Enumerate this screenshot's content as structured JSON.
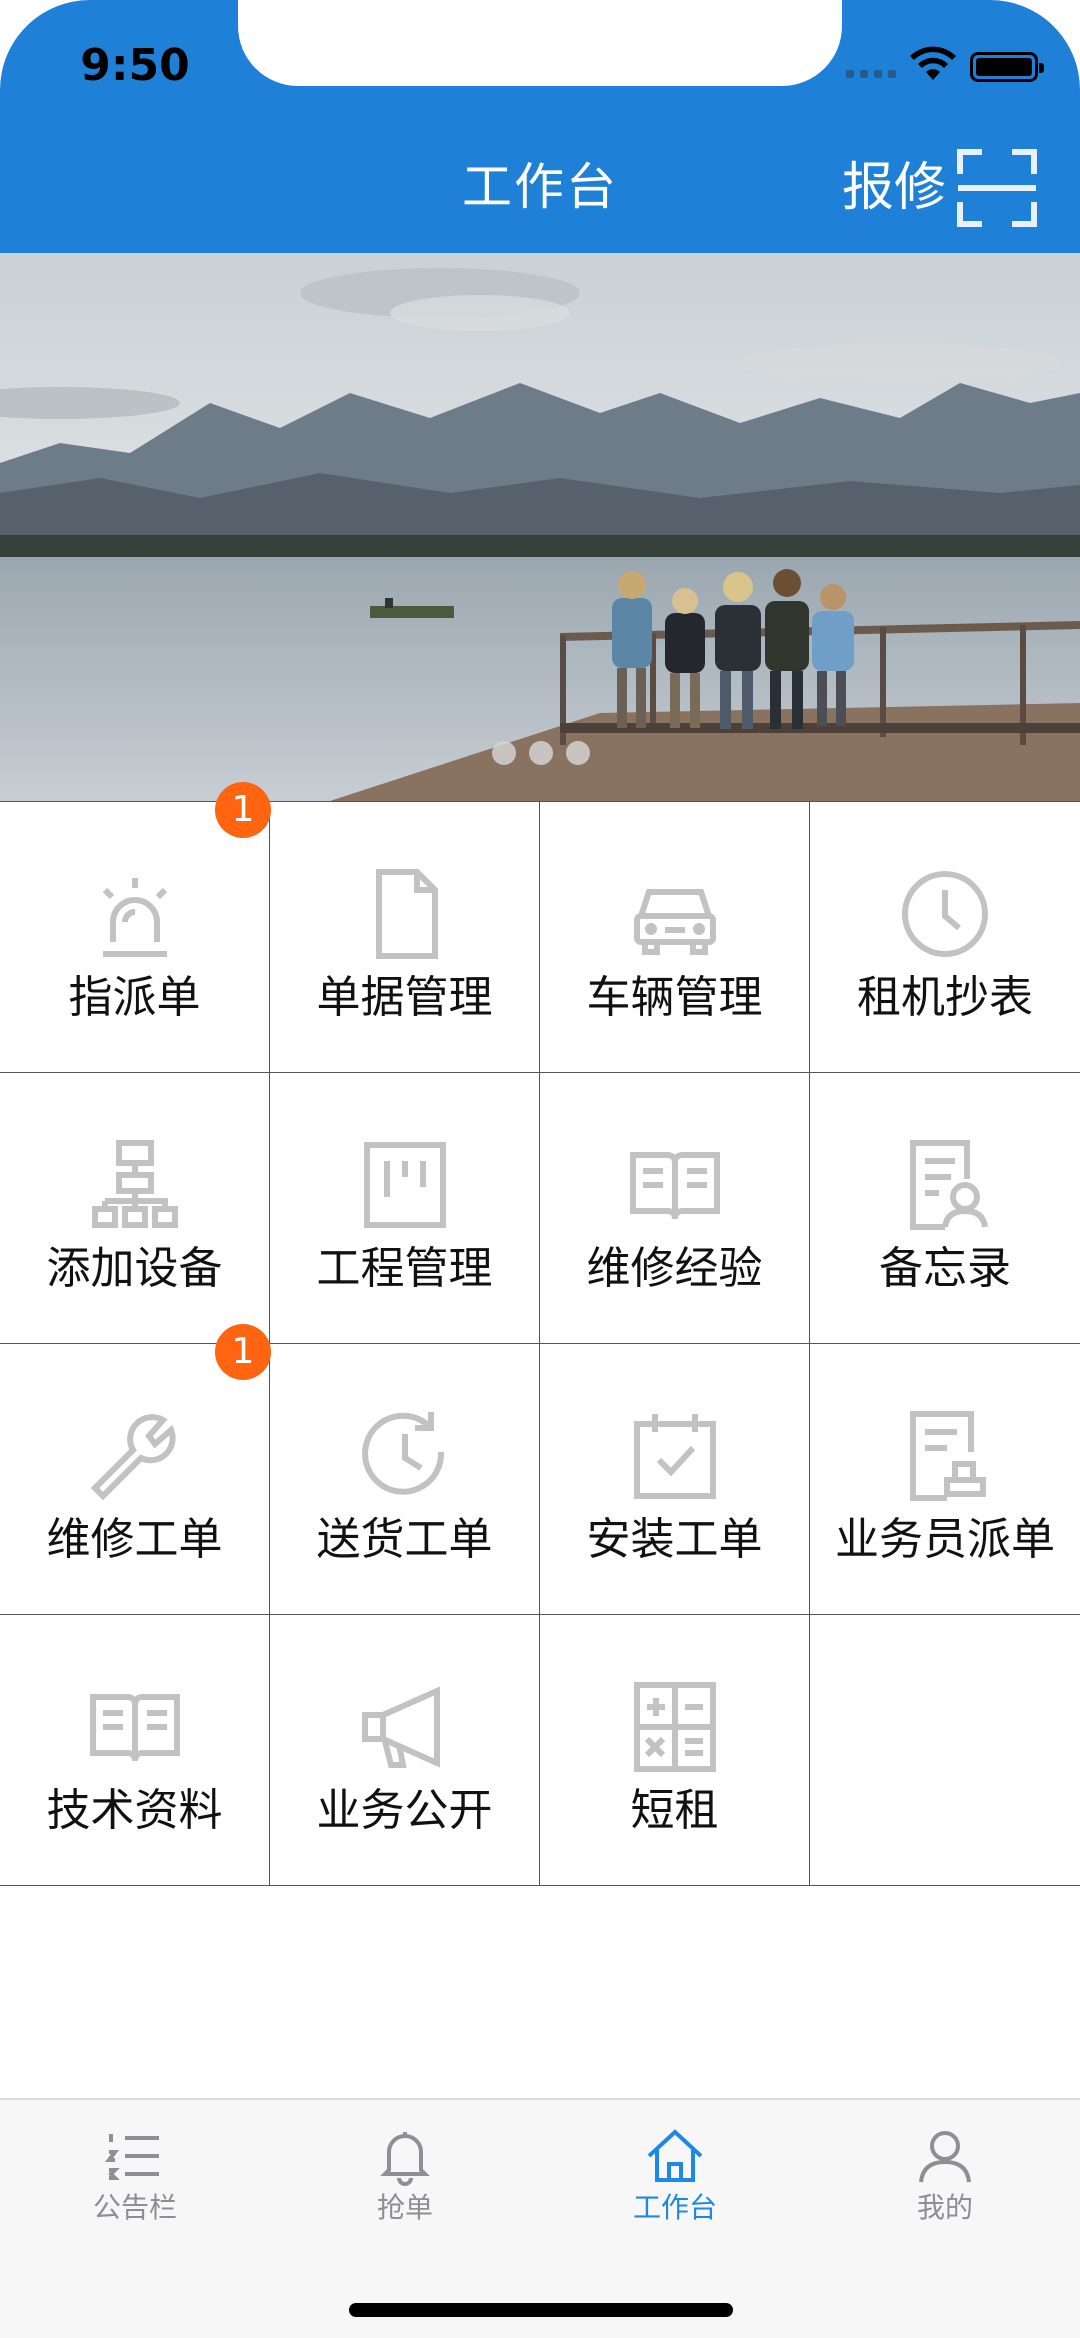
{
  "status_bar": {
    "time": "9:50"
  },
  "header": {
    "title": "工作台",
    "report_label": "报修"
  },
  "grid": {
    "items": [
      {
        "label": "指派单",
        "icon": "alarm-light-icon",
        "badge": "1"
      },
      {
        "label": "单据管理",
        "icon": "document-icon",
        "badge": null
      },
      {
        "label": "车辆管理",
        "icon": "car-icon",
        "badge": null
      },
      {
        "label": "租机抄表",
        "icon": "clock-icon",
        "badge": null
      },
      {
        "label": "添加设备",
        "icon": "device-tree-icon",
        "badge": null
      },
      {
        "label": "工程管理",
        "icon": "kanban-icon",
        "badge": null
      },
      {
        "label": "维修经验",
        "icon": "open-book-icon",
        "badge": null
      },
      {
        "label": "备忘录",
        "icon": "memo-person-icon",
        "badge": null
      },
      {
        "label": "维修工单",
        "icon": "wrench-icon",
        "badge": "1"
      },
      {
        "label": "送货工单",
        "icon": "history-clock-icon",
        "badge": null
      },
      {
        "label": "安装工单",
        "icon": "calendar-check-icon",
        "badge": null
      },
      {
        "label": "业务员派单",
        "icon": "stamp-document-icon",
        "badge": null
      },
      {
        "label": "技术资料",
        "icon": "book-icon",
        "badge": null
      },
      {
        "label": "业务公开",
        "icon": "megaphone-icon",
        "badge": null
      },
      {
        "label": "短租",
        "icon": "calculator-icon",
        "badge": null
      },
      {
        "label": "",
        "icon": null,
        "badge": null
      }
    ]
  },
  "tabbar": {
    "tabs": [
      {
        "label": "公告栏",
        "icon": "list-icon",
        "active": false
      },
      {
        "label": "抢单",
        "icon": "bell-icon",
        "active": false
      },
      {
        "label": "工作台",
        "icon": "home-icon",
        "active": true
      },
      {
        "label": "我的",
        "icon": "user-icon",
        "active": false
      }
    ]
  },
  "colors": {
    "header_blue": "#1e80d6",
    "badge_orange": "#ff6410",
    "icon_gray": "#c2c2c2",
    "tab_active": "#1e88e5",
    "tab_inactive": "#8e8e93"
  }
}
